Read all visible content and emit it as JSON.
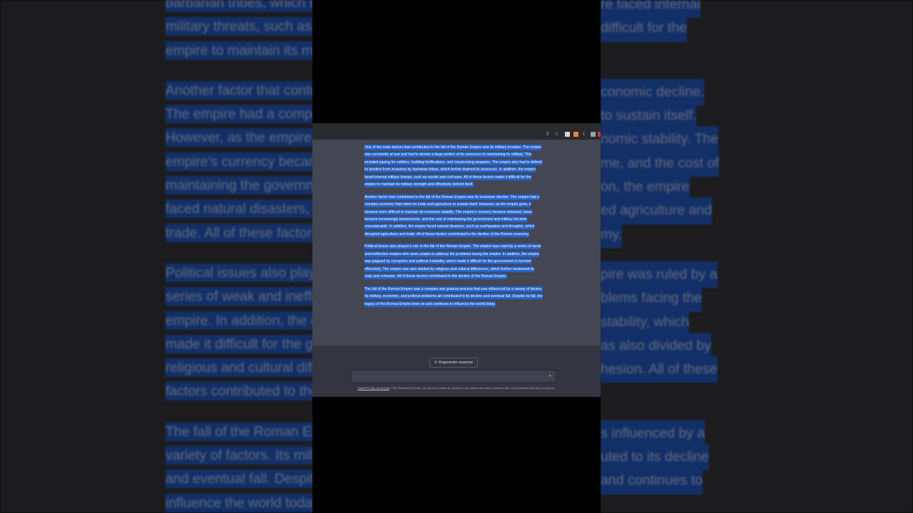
{
  "paragraphs": [
    "One of the main factors that contributed to the fall of the Roman Empire was its military troubles. The empire was constantly at war and had to devote a large portion of its resources to maintaining its military. This included paying for soldiers, building fortifications, and constructing weapons. The empire also had to defend its borders from invasions by barbarian tribes, which further drained its resources. In addition, the empire faced internal military threats, such as revolts and civil wars. All of these factors made it difficult for the empire to maintain its military strength and effectively defend itself.",
    "Another factor that contributed to the fall of the Roman Empire was its economic decline. The empire had a complex economy that relied on trade and agriculture to sustain itself. However, as the empire grew, it became more difficult to maintain its economic stability. The empire's currency became debased, taxes became increasingly burdensome, and the cost of maintaining the government and military became unsustainable. In addition, the empire faced natural disasters, such as earthquakes and droughts, which disrupted agriculture and trade. All of these factors contributed to the decline of the Roman economy.",
    "Political issues also played a role in the fall of the Roman Empire. The empire was ruled by a series of weak and ineffective leaders who were unable to address the problems facing the empire. In addition, the empire was plagued by corruption and political instability, which made it difficult for the government to function effectively. The empire was also divided by religious and cultural differences, which further weakened its unity and cohesion. All of these factors contributed to the decline of the Roman Empire.",
    "The fall of the Roman Empire was a complex and gradual process that was influenced by a variety of factors. Its military, economic, and political problems all contributed to its decline and eventual fall. Despite its fall, the legacy of the Roman Empire lives on and continues to influence the world today."
  ],
  "bg_lines": {
    "p1": [
      "barbarian tribes, which fu",
      "re faced internal",
      "military threats, such as r",
      "difficult for the",
      "empire to maintain its mi"
    ],
    "p2": [
      "Another factor that contr",
      "conomic decline.",
      "The empire had a compl",
      "to sustain itself.",
      "However, as the empire g",
      "nomic stability. The",
      "empire's currency becam",
      "me, and the cost of",
      "maintaining the governm",
      "on, the empire",
      "faced natural disasters, s",
      "ed agriculture and",
      "trade. All of these factors",
      "my."
    ],
    "p3": [
      "Political issues also playe",
      "pire was ruled by a",
      "series of weak and ineffe",
      "blems facing the",
      "empire. In addition, the e",
      "stability, which",
      "made it difficult for the g",
      "as also divided by",
      "religious and cultural diff",
      "hesion. All of these",
      "factors contributed to the"
    ],
    "p4": [
      "The fall of the Roman Em",
      "s influenced by a",
      "variety of factors. Its milit",
      "uted to its decline",
      "and eventual fall. Despite",
      "and continues to",
      "influence the world today"
    ]
  },
  "regenerate_label": "Regenerate response",
  "regenerate_icon": "refresh-icon",
  "disclaimer": {
    "link": "ChatGPT Dec 15 Version",
    "text": ". Free Research Preview. Our goal is to make AI systems more natural and safe to interact with. Your feedback will help us improve."
  },
  "colors": {
    "highlight": "#2563c9",
    "chat_bg": "#444654",
    "page_bg": "#343541"
  }
}
